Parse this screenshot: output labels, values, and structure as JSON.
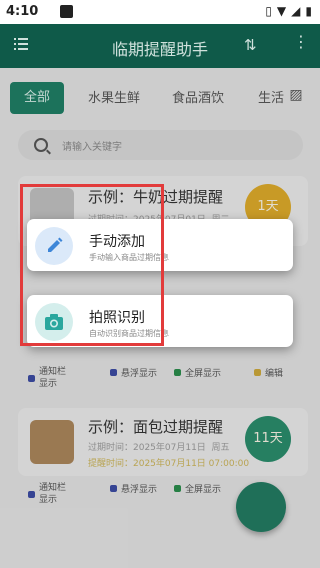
{
  "status_bar": {
    "time": "4:10"
  },
  "toolbar": {
    "title": "临期提醒助手"
  },
  "tabs": [
    {
      "label": "全部",
      "active": true
    },
    {
      "label": "水果生鲜"
    },
    {
      "label": "食品酒饮"
    },
    {
      "label": "生活"
    }
  ],
  "search": {
    "placeholder": "请输入关键字"
  },
  "items": [
    {
      "name": "示例：牛奶过期提醒",
      "expiry": "过期时间：2025年07月01日",
      "weekday": "周二",
      "days": "1天",
      "days_color": "#d9a82a"
    },
    {
      "name": "示例：面包过期提醒",
      "expiry": "过期时间：2025年07月11日",
      "weekday": "周五",
      "remind": "提醒时间：2025年07月11日 07:00:00",
      "days": "11天",
      "days_color": "#2a8a6a"
    }
  ],
  "options": {
    "notify": "通知栏显示",
    "float": "悬浮显示",
    "fullscreen": "全屏显示",
    "edit": "编辑"
  },
  "menu": {
    "manual": {
      "title": "手动添加",
      "subtitle": "手动输入商品过期信息"
    },
    "photo": {
      "title": "拍照识别",
      "subtitle": "自动识别商品过期信息"
    }
  },
  "colors": {
    "toolbar": "#0f5a49",
    "accent": "#1f7c63",
    "highlight_box": "#e23b3b"
  }
}
